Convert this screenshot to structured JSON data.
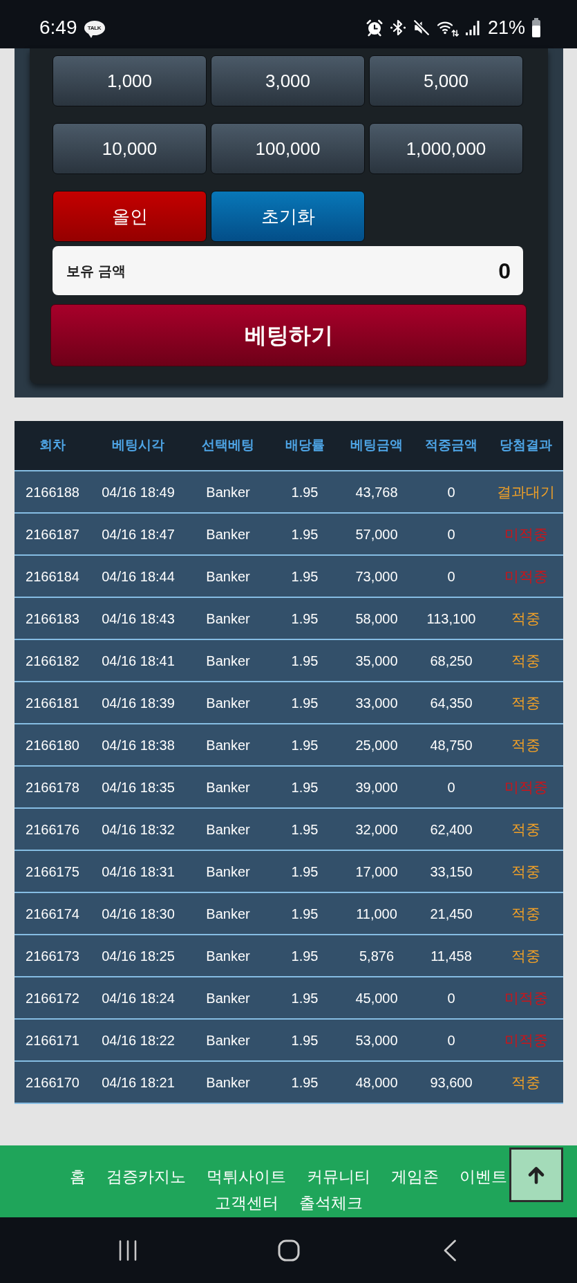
{
  "status_bar": {
    "time": "6:49",
    "notification_badge": "TALK",
    "battery": "21%"
  },
  "bet_panel": {
    "amount_buttons": [
      "1,000",
      "3,000",
      "5,000",
      "10,000",
      "100,000",
      "1,000,000"
    ],
    "action_buttons": [
      {
        "label": "올인",
        "kind": "all_in"
      },
      {
        "label": "초기화",
        "kind": "reset"
      }
    ],
    "balance": {
      "label": "보유 금액",
      "value": "0"
    },
    "submit_button": "베팅하기"
  },
  "history_table": {
    "columns": [
      "회차",
      "베팅시각",
      "선택베팅",
      "배당률",
      "베팅금액",
      "적중금액",
      "당첨결과"
    ],
    "rows": [
      {
        "cells": [
          "2166188",
          "04/16 18:49",
          "Banker",
          "1.95",
          "43,768",
          "0"
        ],
        "result": {
          "text": "결과대기",
          "color": "#f3a126"
        }
      },
      {
        "cells": [
          "2166187",
          "04/16 18:47",
          "Banker",
          "1.95",
          "57,000",
          "0"
        ],
        "result": {
          "text": "미적중",
          "color": "#cc1419"
        }
      },
      {
        "cells": [
          "2166184",
          "04/16 18:44",
          "Banker",
          "1.95",
          "73,000",
          "0"
        ],
        "result": {
          "text": "미적중",
          "color": "#cc1419"
        }
      },
      {
        "cells": [
          "2166183",
          "04/16 18:43",
          "Banker",
          "1.95",
          "58,000",
          "113,100"
        ],
        "result": {
          "text": "적중",
          "color": "#f3a126"
        }
      },
      {
        "cells": [
          "2166182",
          "04/16 18:41",
          "Banker",
          "1.95",
          "35,000",
          "68,250"
        ],
        "result": {
          "text": "적중",
          "color": "#f3a126"
        }
      },
      {
        "cells": [
          "2166181",
          "04/16 18:39",
          "Banker",
          "1.95",
          "33,000",
          "64,350"
        ],
        "result": {
          "text": "적중",
          "color": "#f3a126"
        }
      },
      {
        "cells": [
          "2166180",
          "04/16 18:38",
          "Banker",
          "1.95",
          "25,000",
          "48,750"
        ],
        "result": {
          "text": "적중",
          "color": "#f3a126"
        }
      },
      {
        "cells": [
          "2166178",
          "04/16 18:35",
          "Banker",
          "1.95",
          "39,000",
          "0"
        ],
        "result": {
          "text": "미적중",
          "color": "#cc1419"
        }
      },
      {
        "cells": [
          "2166176",
          "04/16 18:32",
          "Banker",
          "1.95",
          "32,000",
          "62,400"
        ],
        "result": {
          "text": "적중",
          "color": "#f3a126"
        }
      },
      {
        "cells": [
          "2166175",
          "04/16 18:31",
          "Banker",
          "1.95",
          "17,000",
          "33,150"
        ],
        "result": {
          "text": "적중",
          "color": "#f3a126"
        }
      },
      {
        "cells": [
          "2166174",
          "04/16 18:30",
          "Banker",
          "1.95",
          "11,000",
          "21,450"
        ],
        "result": {
          "text": "적중",
          "color": "#f3a126"
        }
      },
      {
        "cells": [
          "2166173",
          "04/16 18:25",
          "Banker",
          "1.95",
          "5,876",
          "11,458"
        ],
        "result": {
          "text": "적중",
          "color": "#f3a126"
        }
      },
      {
        "cells": [
          "2166172",
          "04/16 18:24",
          "Banker",
          "1.95",
          "45,000",
          "0"
        ],
        "result": {
          "text": "미적중",
          "color": "#cc1419"
        }
      },
      {
        "cells": [
          "2166171",
          "04/16 18:22",
          "Banker",
          "1.95",
          "53,000",
          "0"
        ],
        "result": {
          "text": "미적중",
          "color": "#cc1419"
        }
      },
      {
        "cells": [
          "2166170",
          "04/16 18:21",
          "Banker",
          "1.95",
          "48,000",
          "93,600"
        ],
        "result": {
          "text": "적중",
          "color": "#f3a126"
        }
      }
    ]
  },
  "footer": {
    "links": [
      "홈",
      "검증카지노",
      "먹튀사이트",
      "커뮤니티",
      "게임존",
      "이벤트",
      "고객센터",
      "출석체크"
    ]
  }
}
